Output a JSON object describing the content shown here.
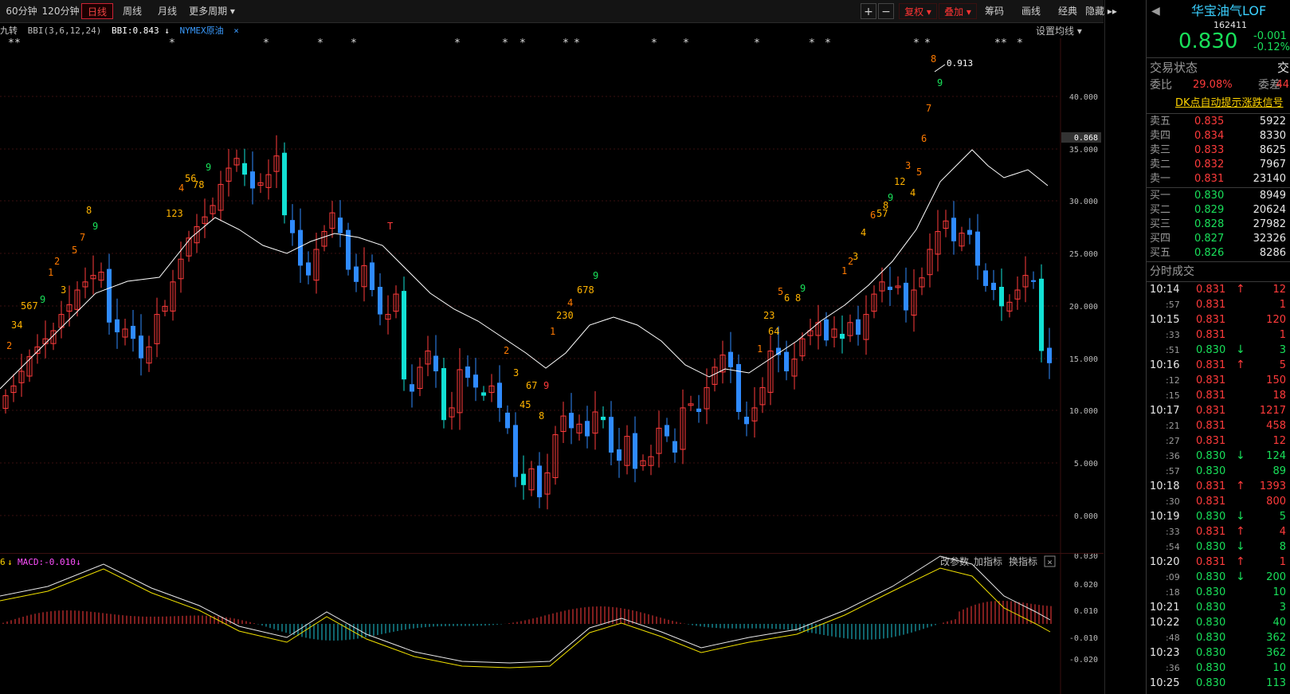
{
  "toolbar": {
    "left_tabs": [
      "60分钟",
      "120分钟",
      "日线",
      "周线",
      "月线",
      "更多周期"
    ],
    "selected_tab": "日线",
    "right_buttons": [
      "复权",
      "叠加",
      "筹码",
      "画线",
      "经典",
      "隐藏"
    ],
    "zoom_in": "+",
    "zoom_out": "−",
    "fullscreen": "⛶"
  },
  "legend": {
    "indicator_name": "九转",
    "bbi_params": "BBI(3,6,12,24)",
    "bbi_value": "BBI:0.843",
    "overlay": "NYMEX原油",
    "close_x": "×",
    "setting": "设置均线"
  },
  "price_axis": {
    "labels": [
      "40.000",
      "35.000",
      "30.000",
      "25.000",
      "20.000",
      "15.000",
      "10.000",
      "5.000",
      "0.000"
    ],
    "current_marker": "0.868",
    "peak_label": "0.913"
  },
  "macd_panel": {
    "prefix": "6",
    "label": "MACD:-0.010",
    "buttons": [
      "改参数",
      "加指标",
      "换指标"
    ],
    "close": "×",
    "axis": [
      "0.030",
      "0.020",
      "0.010",
      "-0.010",
      "-0.020"
    ]
  },
  "quote": {
    "name": "华宝油气LOF",
    "code": "162411",
    "price": "0.830",
    "change": "-0.001",
    "change_pct": "-0.12%",
    "status_label": "交易状态",
    "status_right": "交",
    "ratio_label": "委比",
    "ratio_value": "29.08%",
    "diff_label": "委差",
    "diff_value": "44",
    "signal_link": "DK点自动提示涨跌信号"
  },
  "order_book": {
    "asks": [
      {
        "label": "卖五",
        "price": "0.835",
        "vol": "5922"
      },
      {
        "label": "卖四",
        "price": "0.834",
        "vol": "8330"
      },
      {
        "label": "卖三",
        "price": "0.833",
        "vol": "8625"
      },
      {
        "label": "卖二",
        "price": "0.832",
        "vol": "7967"
      },
      {
        "label": "卖一",
        "price": "0.831",
        "vol": "23140"
      }
    ],
    "bids": [
      {
        "label": "买一",
        "price": "0.830",
        "vol": "8949"
      },
      {
        "label": "买二",
        "price": "0.829",
        "vol": "20624"
      },
      {
        "label": "买三",
        "price": "0.828",
        "vol": "27982"
      },
      {
        "label": "买四",
        "price": "0.827",
        "vol": "32326"
      },
      {
        "label": "买五",
        "price": "0.826",
        "vol": "8286"
      }
    ]
  },
  "ticks": {
    "title": "分时成交",
    "rows": [
      {
        "time": "10:14",
        "price": "0.831",
        "vol": "12",
        "dir": "up"
      },
      {
        "time": ":57",
        "price": "0.831",
        "vol": "1",
        "dir": "none"
      },
      {
        "time": "10:15",
        "price": "0.831",
        "vol": "120",
        "dir": "none"
      },
      {
        "time": ":33",
        "price": "0.831",
        "vol": "1",
        "dir": "none"
      },
      {
        "time": ":51",
        "price": "0.830",
        "vol": "3",
        "dir": "down"
      },
      {
        "time": "10:16",
        "price": "0.831",
        "vol": "5",
        "dir": "up"
      },
      {
        "time": ":12",
        "price": "0.831",
        "vol": "150",
        "dir": "none"
      },
      {
        "time": ":15",
        "price": "0.831",
        "vol": "18",
        "dir": "none"
      },
      {
        "time": "10:17",
        "price": "0.831",
        "vol": "1217",
        "dir": "none"
      },
      {
        "time": ":21",
        "price": "0.831",
        "vol": "458",
        "dir": "none"
      },
      {
        "time": ":27",
        "price": "0.831",
        "vol": "12",
        "dir": "none"
      },
      {
        "time": ":36",
        "price": "0.830",
        "vol": "124",
        "dir": "down"
      },
      {
        "time": ":57",
        "price": "0.830",
        "vol": "89",
        "dir": "none"
      },
      {
        "time": "10:18",
        "price": "0.831",
        "vol": "1393",
        "dir": "up"
      },
      {
        "time": ":30",
        "price": "0.831",
        "vol": "800",
        "dir": "none"
      },
      {
        "time": "10:19",
        "price": "0.830",
        "vol": "5",
        "dir": "down"
      },
      {
        "time": ":33",
        "price": "0.831",
        "vol": "4",
        "dir": "up"
      },
      {
        "time": ":54",
        "price": "0.830",
        "vol": "8",
        "dir": "down"
      },
      {
        "time": "10:20",
        "price": "0.831",
        "vol": "1",
        "dir": "up"
      },
      {
        "time": ":09",
        "price": "0.830",
        "vol": "200",
        "dir": "down"
      },
      {
        "time": ":18",
        "price": "0.830",
        "vol": "10",
        "dir": "none"
      },
      {
        "time": "10:21",
        "price": "0.830",
        "vol": "3",
        "dir": "none"
      },
      {
        "time": "10:22",
        "price": "0.830",
        "vol": "40",
        "dir": "none"
      },
      {
        "time": ":48",
        "price": "0.830",
        "vol": "362",
        "dir": "none"
      },
      {
        "time": "10:23",
        "price": "0.830",
        "vol": "362",
        "dir": "none"
      },
      {
        "time": ":36",
        "price": "0.830",
        "vol": "10",
        "dir": "none"
      },
      {
        "time": "10:25",
        "price": "0.830",
        "vol": "113",
        "dir": "none"
      }
    ]
  },
  "colors": {
    "up": "#ff3b3b",
    "down": "#2f8bff",
    "cyan": "#12e0d4",
    "accent": "#ffd400",
    "bbi_line": "#ffffff"
  }
}
